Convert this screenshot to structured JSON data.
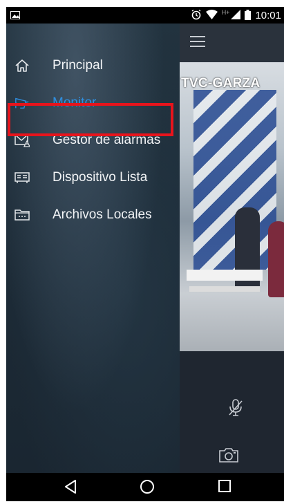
{
  "status_bar": {
    "network_label": "H+",
    "time": "10:01"
  },
  "drawer": {
    "items": [
      {
        "label": "Principal",
        "icon": "home-icon",
        "active": false
      },
      {
        "label": "Monitor",
        "icon": "cctv-camera-icon",
        "active": true
      },
      {
        "label": "Gestor de alarmas",
        "icon": "alarm-mail-icon",
        "active": false,
        "highlighted": true
      },
      {
        "label": "Dispositivo Lista",
        "icon": "device-recorder-icon",
        "active": false
      },
      {
        "label": "Archivos Locales",
        "icon": "folder-icon",
        "active": false
      }
    ]
  },
  "main": {
    "camera_name": "TVC-GARZA"
  },
  "colors": {
    "active": "#2f8fe0",
    "highlight_border": "#e8141c",
    "menu_text": "#f2f4f6",
    "drawer_bg": "#1d2c38"
  }
}
